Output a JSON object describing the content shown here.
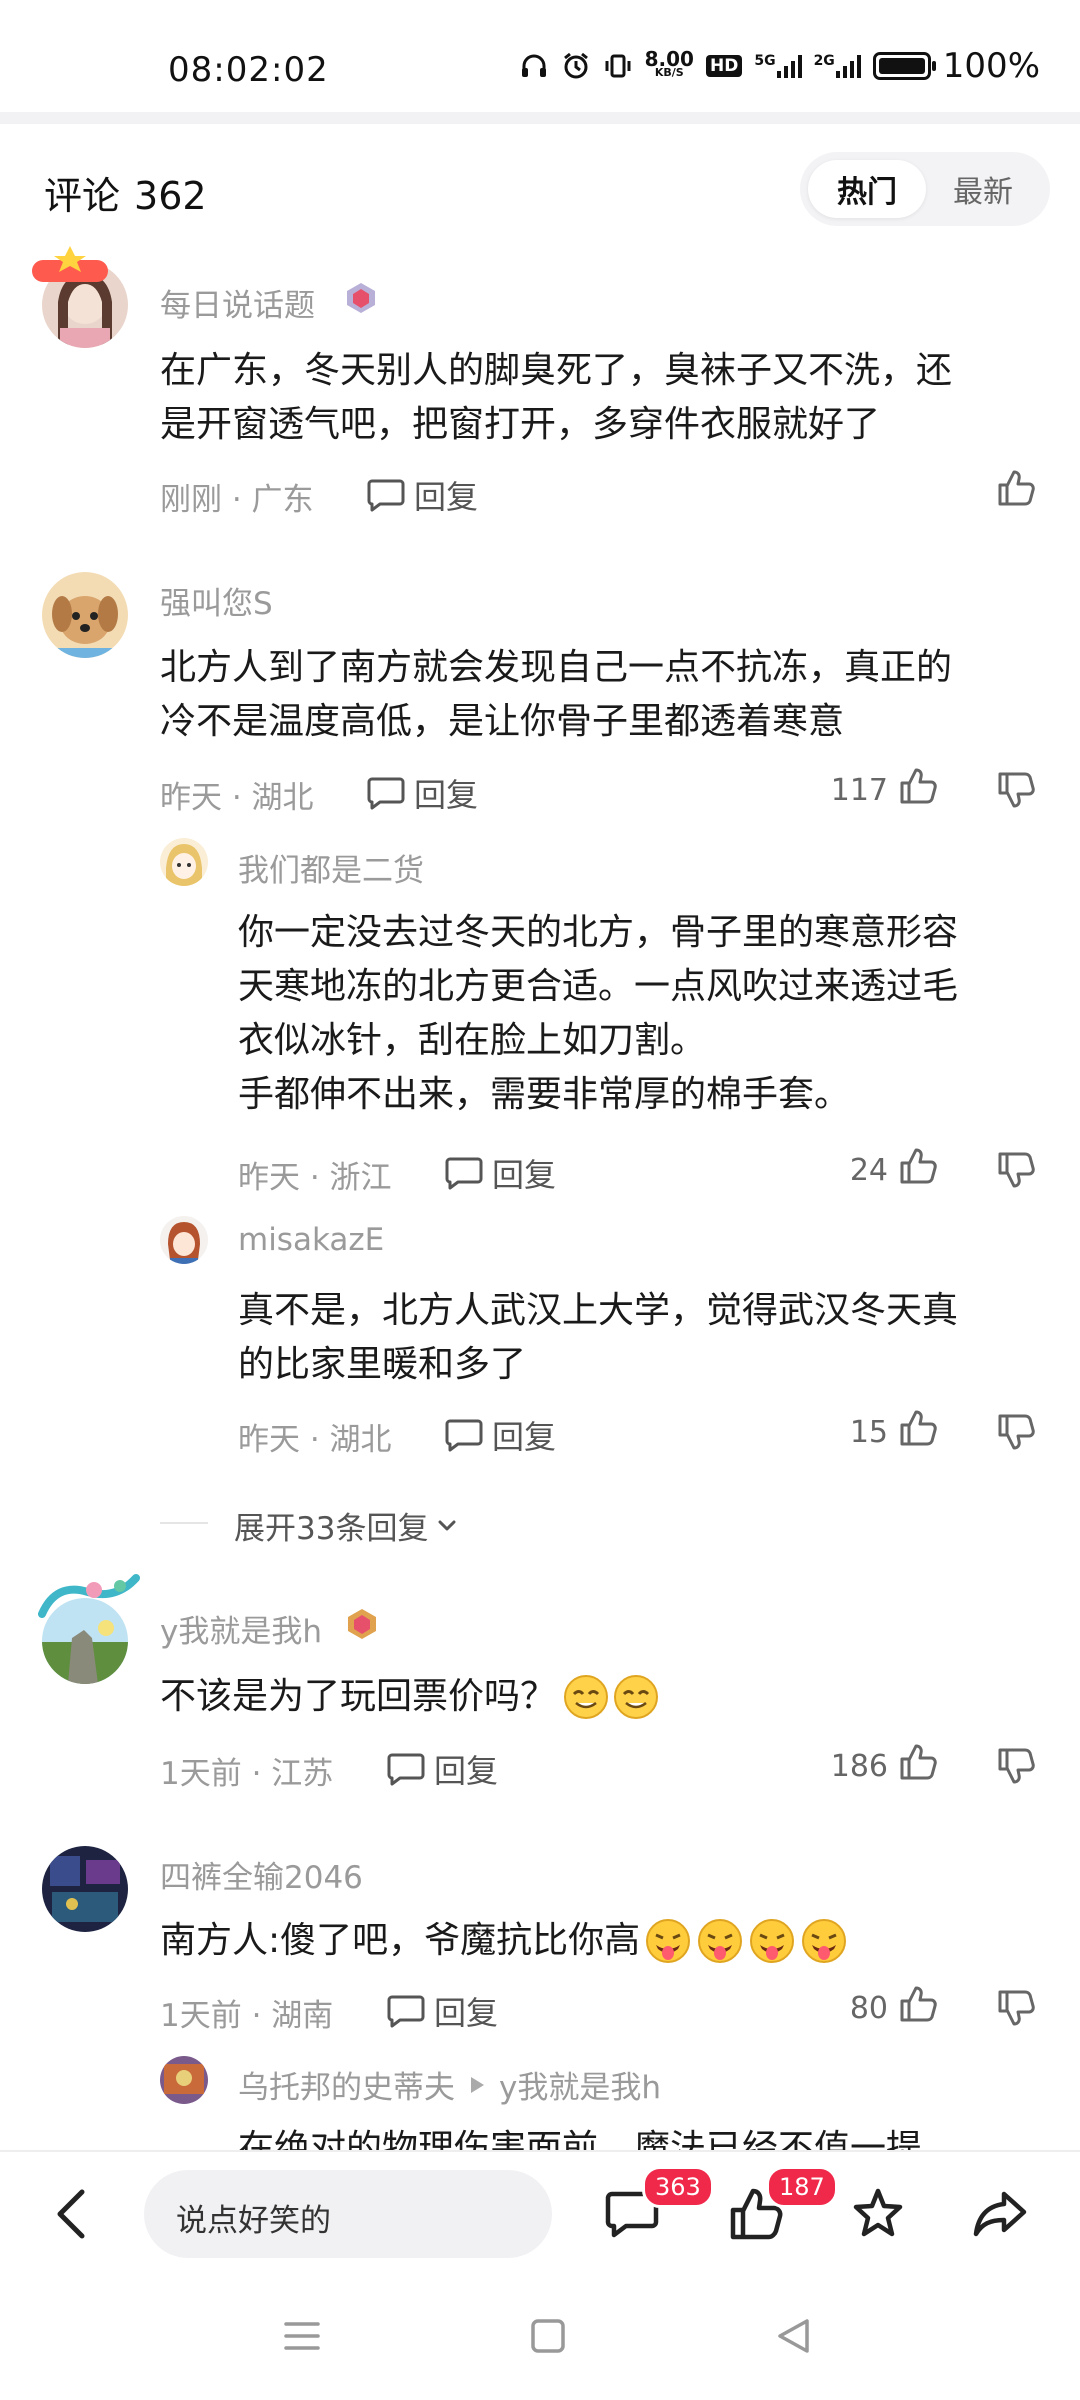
{
  "status_bar": {
    "time": "08:02:02",
    "net_speed": "8.00",
    "net_unit": "KB/S",
    "hd_label": "HD",
    "sig1_label": "5G",
    "sig2_label": "2G",
    "battery_pct": "100%",
    "battery_level": 1.0
  },
  "header": {
    "title": "评论",
    "count": "362",
    "sort_hot": "热门",
    "sort_new": "最新"
  },
  "comments": [
    {
      "username": "每日说话题",
      "text_lines": [
        "在广东，冬天别人的脚臭死了，臭袜子又不洗，还",
        "是开窗透气吧，把窗打开，多穿件衣服就好了"
      ],
      "meta": "刚刚 · 广东",
      "reply": "回复"
    },
    {
      "username": "强叫您S",
      "text_lines": [
        "北方人到了南方就会发现自己一点不抗冻，真正的",
        "冷不是温度高低，是让你骨子里都透着寒意"
      ],
      "meta": "昨天 · 湖北",
      "reply": "回复",
      "likes": "117"
    },
    {
      "username": "y我就是我h",
      "text": "不该是为了玩回票价吗？",
      "meta": "1天前 · 江苏",
      "reply": "回复",
      "likes": "186"
    },
    {
      "username": "四裤全输2046",
      "text": "南方人:傻了吧，爷魔抗比你高",
      "meta": "1天前 · 湖南",
      "reply": "回复",
      "likes": "80"
    }
  ],
  "replies": [
    {
      "username": "我们都是二货",
      "text_lines": [
        "你一定没去过冬天的北方，骨子里的寒意形容",
        "天寒地冻的北方更合适。一点风吹过来透过毛",
        "衣似冰针，刮在脸上如刀割。",
        "手都伸不出来，需要非常厚的棉手套。"
      ],
      "meta": "昨天 · 浙江",
      "reply": "回复",
      "likes": "24"
    },
    {
      "username": "misakazE",
      "text_lines": [
        "真不是，北方人武汉上大学，觉得武汉冬天真",
        "的比家里暖和多了"
      ],
      "meta": "昨天 · 湖北",
      "reply": "回复",
      "likes": "15"
    },
    {
      "username": "乌托邦的史蒂夫",
      "reply_to": "y我就是我h",
      "text": "在绝对的物理伤害面前，魔法已经不值一提"
    }
  ],
  "expand_replies": "展开33条回复",
  "bottom_bar": {
    "input_placeholder": "说点好笑的",
    "comment_count": "363",
    "like_count": "187"
  },
  "icons": {
    "status": [
      "headphones-icon",
      "alarm-icon",
      "vibrate-icon",
      "battery-icon"
    ],
    "actions": [
      "back-icon",
      "comment-icon",
      "like-icon",
      "star-icon",
      "share-icon"
    ],
    "nav": [
      "menu-nav-icon",
      "home-nav-icon",
      "back-nav-icon"
    ]
  },
  "colors": {
    "badge": "#f0284a",
    "muted_text": "#9a9a9a",
    "body_text": "#1a1a1a"
  }
}
